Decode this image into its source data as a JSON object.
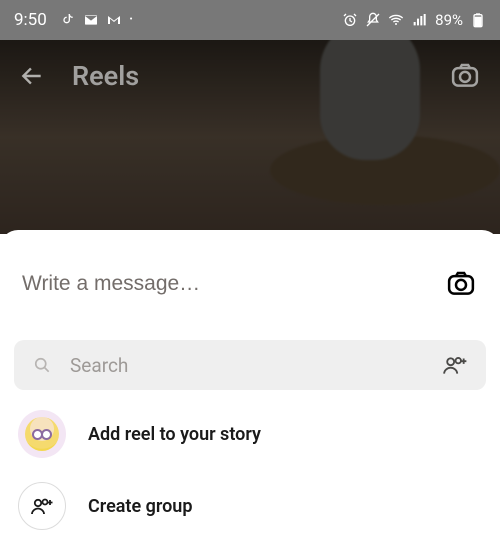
{
  "statusbar": {
    "time": "9:50",
    "battery": "89%"
  },
  "reels": {
    "title": "Reels"
  },
  "sheet": {
    "message_placeholder": "Write a message…",
    "search_placeholder": "Search"
  },
  "actions": {
    "add_reel": "Add reel to your story",
    "create_group": "Create group"
  }
}
